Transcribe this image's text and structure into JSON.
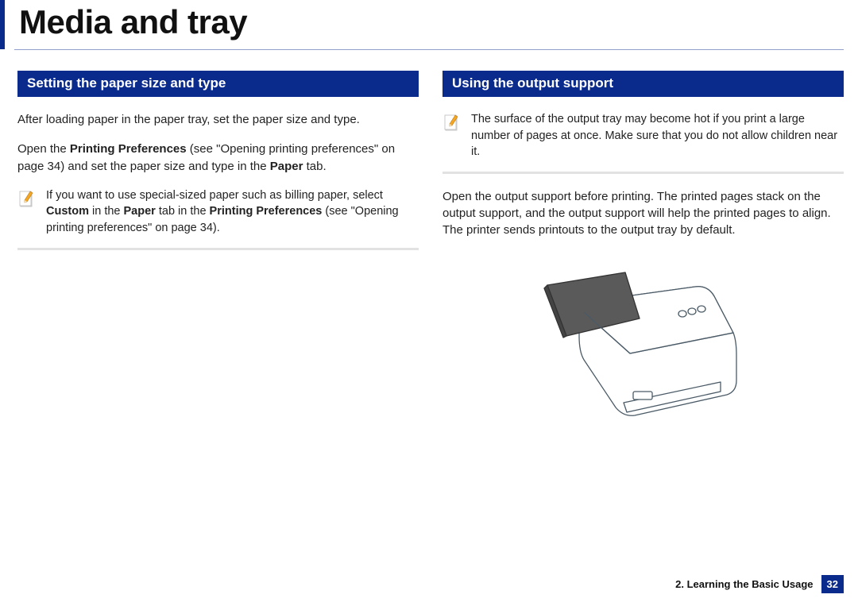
{
  "title": "Media and tray",
  "left": {
    "heading": "Setting the paper size and type",
    "para1": "After loading paper in the paper tray, set the paper size and type.",
    "para2_pre": "Open the ",
    "para2_bold1": "Printing Preferences",
    "para2_mid": " (see \"Opening printing preferences\" on page 34) and set the paper size and type in the ",
    "para2_bold2": "Paper",
    "para2_post": " tab.",
    "note_pre": "If you want to use special-sized paper such as billing paper, select ",
    "note_bold1": "Custom",
    "note_mid1": " in the ",
    "note_bold2": "Paper",
    "note_mid2": " tab in the ",
    "note_bold3": "Printing Preferences",
    "note_post": " (see \"Opening printing preferences\" on page 34)."
  },
  "right": {
    "heading": "Using the output support",
    "note": "The surface of the output tray may become hot if you print a large number of pages at once. Make sure that you do not allow children near it.",
    "para": "Open the output support before printing. The printed pages stack on the output support, and the output support will help the printed pages to align. The printer sends printouts to the output tray by default."
  },
  "footer": {
    "chapter": "2. Learning the Basic Usage",
    "page": "32"
  }
}
